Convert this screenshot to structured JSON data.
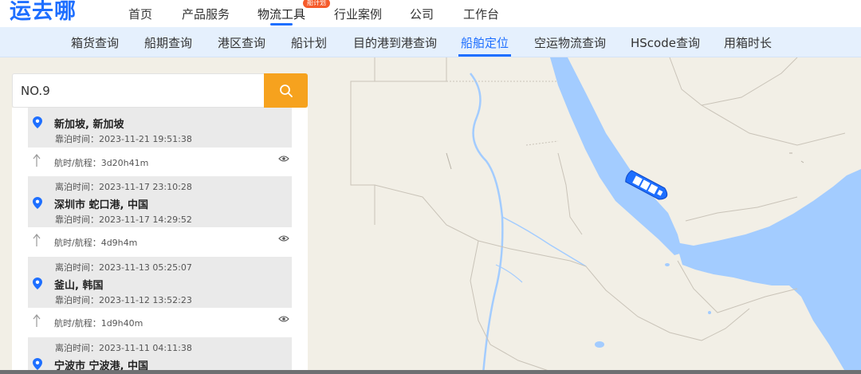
{
  "logo": "运去哪",
  "nav": {
    "items": [
      "首页",
      "产品服务",
      "物流工具",
      "行业案例",
      "公司",
      "工作台"
    ],
    "active_badge": "船计划"
  },
  "subnav": {
    "items": [
      "箱货查询",
      "船期查询",
      "港区查询",
      "船计划",
      "目的港到港查询",
      "船舶定位",
      "空运物流查询",
      "HScode查询",
      "用箱时长"
    ],
    "active": "船舶定位"
  },
  "search": {
    "value": "NO.9"
  },
  "route": {
    "ports": [
      {
        "depart": "",
        "name": "新加坡, 新加坡",
        "berth": "靠泊时间：2023-11-21 19:51:38"
      },
      {
        "depart": "离泊时间：2023-11-17 23:10:28",
        "name": "深圳市 蛇口港, 中国",
        "berth": "靠泊时间：2023-11-17 14:29:52"
      },
      {
        "depart": "离泊时间：2023-11-13 05:25:07",
        "name": "釜山, 韩国",
        "berth": "靠泊时间：2023-11-12 13:52:23"
      },
      {
        "depart": "离泊时间：2023-11-11 04:11:38",
        "name": "宁波市 宁波港, 中国",
        "berth": ""
      }
    ],
    "voyages": [
      "航时/航程：3d20h41m",
      "航时/航程：4d9h4m",
      "航时/航程：1d9h40m"
    ]
  },
  "colors": {
    "accent": "#1e6fff",
    "search_button": "#f6a21e",
    "sea": "#a3ccff",
    "land": "#f2efe6"
  }
}
